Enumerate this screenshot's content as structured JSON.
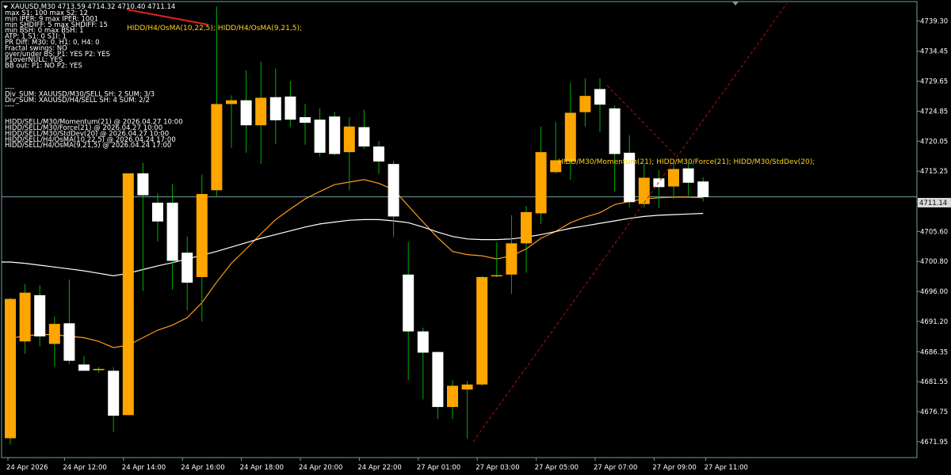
{
  "header": {
    "symbol_line": "XAUUSD,M30  4713.59 4714.32 4710.40 4711.14"
  },
  "info_lines": [
    "max S1: 100 max S2: 12",
    "min IPER: 9 max IPER: 1001",
    "min SHDIFF: 5 max SHDIFF: 15",
    "min BSH: 0 max BSH: 1",
    "ATP: 1 S1: 0 S1I: 1",
    "PR Diff: M30: 0, H1: 0, H4: 0",
    "Fractal swings:  NO",
    "over/under BS:  P1: YES  P2: YES",
    "P1overNULL:  YES",
    "BB out:  P1: NO  P2: YES",
    "----",
    "Div_SUM: XAUUSD/M30/SELL SH: 2 SUM: 3/3",
    "Div_SUM: XAUUSD/H4/SELL SH: 4 SUM: 2/2",
    "----",
    "HIDD/SELL/M30/Momentum(21) @ 2026.04.27 10:00",
    "HIDD/SELL/M30/Force(21) @ 2026.04.27 10:00",
    "HIDD/SELL/M30/StdDev(20) @ 2026.04.27 10:00",
    "HIDD/SELL/H4/OsMA(10,22,5) @ 2026.04.24 17:00",
    "HIDD/SELL/H4/OsMA(9,21,5) @ 2026.04.24 17:00"
  ],
  "annotations": {
    "h4": "HIDD/H4/OsMA(10,22,5); HIDD/H4/OsMA(9,21,5);",
    "m30": "HIDD/M30/Momentum(21); HIDD/M30/Force(21); HIDD/M30/StdDev(20);"
  },
  "current_price_label": "4711.14",
  "chart_data": {
    "type": "candlestick",
    "title": "XAUUSD,M30",
    "ylim": [
      4669.4,
      4742.4
    ],
    "y_ticks": [
      "4739.30",
      "4734.45",
      "4729.65",
      "4724.85",
      "4720.05",
      "4715.25",
      "4710.40",
      "4705.60",
      "4700.80",
      "4696.00",
      "4691.20",
      "4686.35",
      "4681.55",
      "4676.75",
      "4671.95"
    ],
    "x_ticks": [
      "24 Apr 2026",
      "24 Apr 12:00",
      "24 Apr 14:00",
      "24 Apr 16:00",
      "24 Apr 18:00",
      "24 Apr 20:00",
      "24 Apr 22:00",
      "27 Apr 01:00",
      "27 Apr 03:00",
      "27 Apr 05:00",
      "27 Apr 07:00",
      "27 Apr 09:00",
      "27 Apr 11:00"
    ],
    "current_price": 4711.14,
    "candles": [
      {
        "o": 4672.5,
        "h": 4695.0,
        "l": 4671.5,
        "c": 4694.8
      },
      {
        "o": 4688.0,
        "h": 4697.2,
        "l": 4686.0,
        "c": 4695.8
      },
      {
        "o": 4695.4,
        "h": 4697.0,
        "l": 4687.2,
        "c": 4688.8
      },
      {
        "o": 4687.6,
        "h": 4692.0,
        "l": 4684.0,
        "c": 4690.8
      },
      {
        "o": 4690.9,
        "h": 4697.9,
        "l": 4684.4,
        "c": 4684.9
      },
      {
        "o": 4684.3,
        "h": 4685.6,
        "l": 4683.3,
        "c": 4683.3
      },
      {
        "o": 4683.4,
        "h": 4683.9,
        "l": 4683.0,
        "c": 4683.6
      },
      {
        "o": 4683.3,
        "h": 4683.9,
        "l": 4673.5,
        "c": 4676.1
      },
      {
        "o": 4676.2,
        "h": 4714.9,
        "l": 4676.2,
        "c": 4714.9
      },
      {
        "o": 4714.9,
        "h": 4716.6,
        "l": 4696.1,
        "c": 4711.4
      },
      {
        "o": 4710.2,
        "h": 4711.7,
        "l": 4704.0,
        "c": 4707.2
      },
      {
        "o": 4710.2,
        "h": 4713.2,
        "l": 4696.3,
        "c": 4700.9
      },
      {
        "o": 4702.2,
        "h": 4704.8,
        "l": 4693.0,
        "c": 4697.4
      },
      {
        "o": 4698.3,
        "h": 4714.7,
        "l": 4691.2,
        "c": 4711.6
      },
      {
        "o": 4712.2,
        "h": 4741.6,
        "l": 4711.2,
        "c": 4726.0
      },
      {
        "o": 4726.0,
        "h": 4727.4,
        "l": 4719.0,
        "c": 4726.6
      },
      {
        "o": 4726.6,
        "h": 4731.4,
        "l": 4718.2,
        "c": 4722.6
      },
      {
        "o": 4722.6,
        "h": 4732.8,
        "l": 4716.4,
        "c": 4727.0
      },
      {
        "o": 4727.1,
        "h": 4731.7,
        "l": 4719.6,
        "c": 4723.4
      },
      {
        "o": 4727.2,
        "h": 4729.7,
        "l": 4722.3,
        "c": 4723.5
      },
      {
        "o": 4723.9,
        "h": 4726.0,
        "l": 4719.5,
        "c": 4723.0
      },
      {
        "o": 4723.5,
        "h": 4725.3,
        "l": 4717.6,
        "c": 4718.2
      },
      {
        "o": 4724.0,
        "h": 4724.7,
        "l": 4717.8,
        "c": 4718.0
      },
      {
        "o": 4718.3,
        "h": 4723.9,
        "l": 4712.2,
        "c": 4722.4
      },
      {
        "o": 4722.3,
        "h": 4725.1,
        "l": 4718.8,
        "c": 4719.2
      },
      {
        "o": 4719.2,
        "h": 4720.1,
        "l": 4714.8,
        "c": 4716.8
      },
      {
        "o": 4716.4,
        "h": 4716.9,
        "l": 4704.7,
        "c": 4708.0
      },
      {
        "o": 4698.7,
        "h": 4703.9,
        "l": 4681.8,
        "c": 4689.6
      },
      {
        "o": 4689.6,
        "h": 4690.2,
        "l": 4678.7,
        "c": 4686.2
      },
      {
        "o": 4686.3,
        "h": 4686.4,
        "l": 4675.6,
        "c": 4677.5
      },
      {
        "o": 4677.5,
        "h": 4681.8,
        "l": 4675.6,
        "c": 4680.9
      },
      {
        "o": 4680.3,
        "h": 4681.7,
        "l": 4672.4,
        "c": 4681.1
      },
      {
        "o": 4681.1,
        "h": 4698.5,
        "l": 4680.9,
        "c": 4698.3
      },
      {
        "o": 4698.5,
        "h": 4703.9,
        "l": 4698.3,
        "c": 4698.6
      },
      {
        "o": 4698.7,
        "h": 4708.2,
        "l": 4695.6,
        "c": 4703.7
      },
      {
        "o": 4703.7,
        "h": 4709.7,
        "l": 4699.0,
        "c": 4708.7
      },
      {
        "o": 4708.5,
        "h": 4722.4,
        "l": 4706.8,
        "c": 4718.3
      },
      {
        "o": 4715.1,
        "h": 4723.1,
        "l": 4714.9,
        "c": 4717.0
      },
      {
        "o": 4716.8,
        "h": 4729.4,
        "l": 4713.9,
        "c": 4724.6
      },
      {
        "o": 4724.7,
        "h": 4730.1,
        "l": 4722.4,
        "c": 4727.3
      },
      {
        "o": 4728.4,
        "h": 4730.1,
        "l": 4721.5,
        "c": 4725.9
      },
      {
        "o": 4725.3,
        "h": 4725.8,
        "l": 4712.0,
        "c": 4718.0
      },
      {
        "o": 4718.2,
        "h": 4721.0,
        "l": 4709.4,
        "c": 4710.3
      },
      {
        "o": 4710.0,
        "h": 4716.4,
        "l": 4709.4,
        "c": 4714.2
      },
      {
        "o": 4714.1,
        "h": 4715.4,
        "l": 4709.4,
        "c": 4712.7
      },
      {
        "o": 4712.8,
        "h": 4716.7,
        "l": 4710.8,
        "c": 4715.6
      },
      {
        "o": 4715.7,
        "h": 4716.6,
        "l": 4711.3,
        "c": 4713.4
      },
      {
        "o": 4713.6,
        "h": 4714.3,
        "l": 4710.4,
        "c": 4711.1
      }
    ],
    "series": [
      {
        "name": "",
        "color": "#ff9d1a",
        "values": [
          4688.5,
          4688.9,
          4689.1,
          4689.1,
          4688.8,
          4688.6,
          4688.0,
          4687.0,
          4687.4,
          4688.6,
          4689.8,
          4690.6,
          4691.8,
          4694.2,
          4697.5,
          4700.5,
          4702.8,
          4705.2,
          4707.5,
          4709.2,
          4710.8,
          4712.0,
          4713.1,
          4713.5,
          4713.9,
          4713.3,
          4712.3,
          4709.7,
          4707.1,
          4704.6,
          4702.4,
          4701.9,
          4701.7,
          4701.2,
          4701.7,
          4702.8,
          4704.5,
          4705.6,
          4707.0,
          4707.9,
          4708.6,
          4709.9,
          4710.4,
          4710.8,
          4711.0,
          4711.1,
          4711.1,
          4711.0
        ]
      },
      {
        "name": "",
        "color": "#ffffff",
        "values": [
          4700.7,
          4700.5,
          4700.2,
          4699.9,
          4699.6,
          4699.3,
          4698.9,
          4698.5,
          4698.9,
          4699.5,
          4700.1,
          4700.6,
          4701.2,
          4701.8,
          4702.4,
          4703.1,
          4703.8,
          4704.5,
          4705.1,
          4705.7,
          4706.3,
          4706.8,
          4707.1,
          4707.4,
          4707.5,
          4707.5,
          4707.3,
          4707.0,
          4706.3,
          4705.5,
          4704.8,
          4704.4,
          4704.3,
          4704.3,
          4704.4,
          4704.7,
          4705.1,
          4705.6,
          4706.1,
          4706.5,
          4706.9,
          4707.3,
          4707.7,
          4708.0,
          4708.2,
          4708.3,
          4708.4,
          4708.5
        ]
      }
    ],
    "colors": {
      "bull_candle": "#ffa500",
      "bear_candle": "#ffffff",
      "bull_wick": "#00b000",
      "bear_wick": "#00b000",
      "grid_line": "#6fa0a0",
      "div_line_red": "#e02020",
      "div_line_dashed": "#b01010",
      "annotation_text": "#ffd21f"
    }
  }
}
